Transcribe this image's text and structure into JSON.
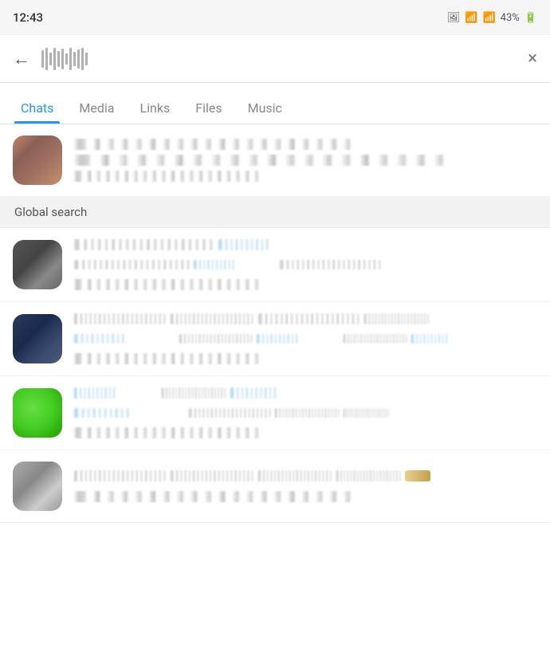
{
  "statusBar": {
    "time": "12:43",
    "batteryPercent": "43%"
  },
  "header": {
    "backLabel": "←",
    "closeLabel": "×"
  },
  "tabs": [
    {
      "id": "chats",
      "label": "Chats",
      "active": true
    },
    {
      "id": "media",
      "label": "Media",
      "active": false
    },
    {
      "id": "links",
      "label": "Links",
      "active": false
    },
    {
      "id": "files",
      "label": "Files",
      "active": false
    },
    {
      "id": "music",
      "label": "Music",
      "active": false
    }
  ],
  "globalSearchLabel": "Global search",
  "chatItems": [
    {
      "id": "1",
      "avatarStyle": "warm"
    },
    {
      "id": "2",
      "avatarStyle": "dark-gray"
    },
    {
      "id": "3",
      "avatarStyle": "dark-blue"
    },
    {
      "id": "4",
      "avatarStyle": "green"
    },
    {
      "id": "5",
      "avatarStyle": "silver"
    }
  ]
}
